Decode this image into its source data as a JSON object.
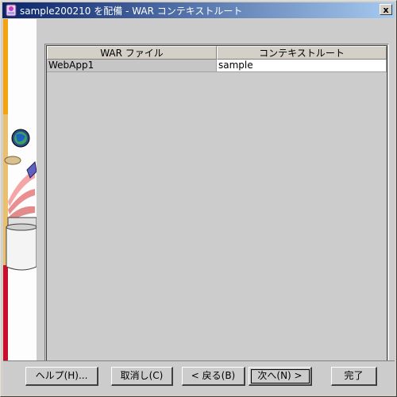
{
  "window": {
    "title": "sample200210 を配備 - WAR コンテキストルート",
    "close_label": "x"
  },
  "table": {
    "columns": [
      "WAR ファイル",
      "コンテキストルート"
    ],
    "rows": [
      {
        "war_file": "WebApp1",
        "context_root": "sample"
      }
    ]
  },
  "buttons": {
    "help": "ヘルプ(H)...",
    "cancel": "取消し(C)",
    "back": "< 戻る(B)",
    "next": "次へ(N) >",
    "finish": "完了"
  },
  "colors": {
    "title_gradient_start": "#0a246a",
    "title_gradient_end": "#a6caf0",
    "panel_background": "#cccccc",
    "side_stripe_orange": "#f2a30f",
    "side_stripe_red": "#c8102e"
  }
}
